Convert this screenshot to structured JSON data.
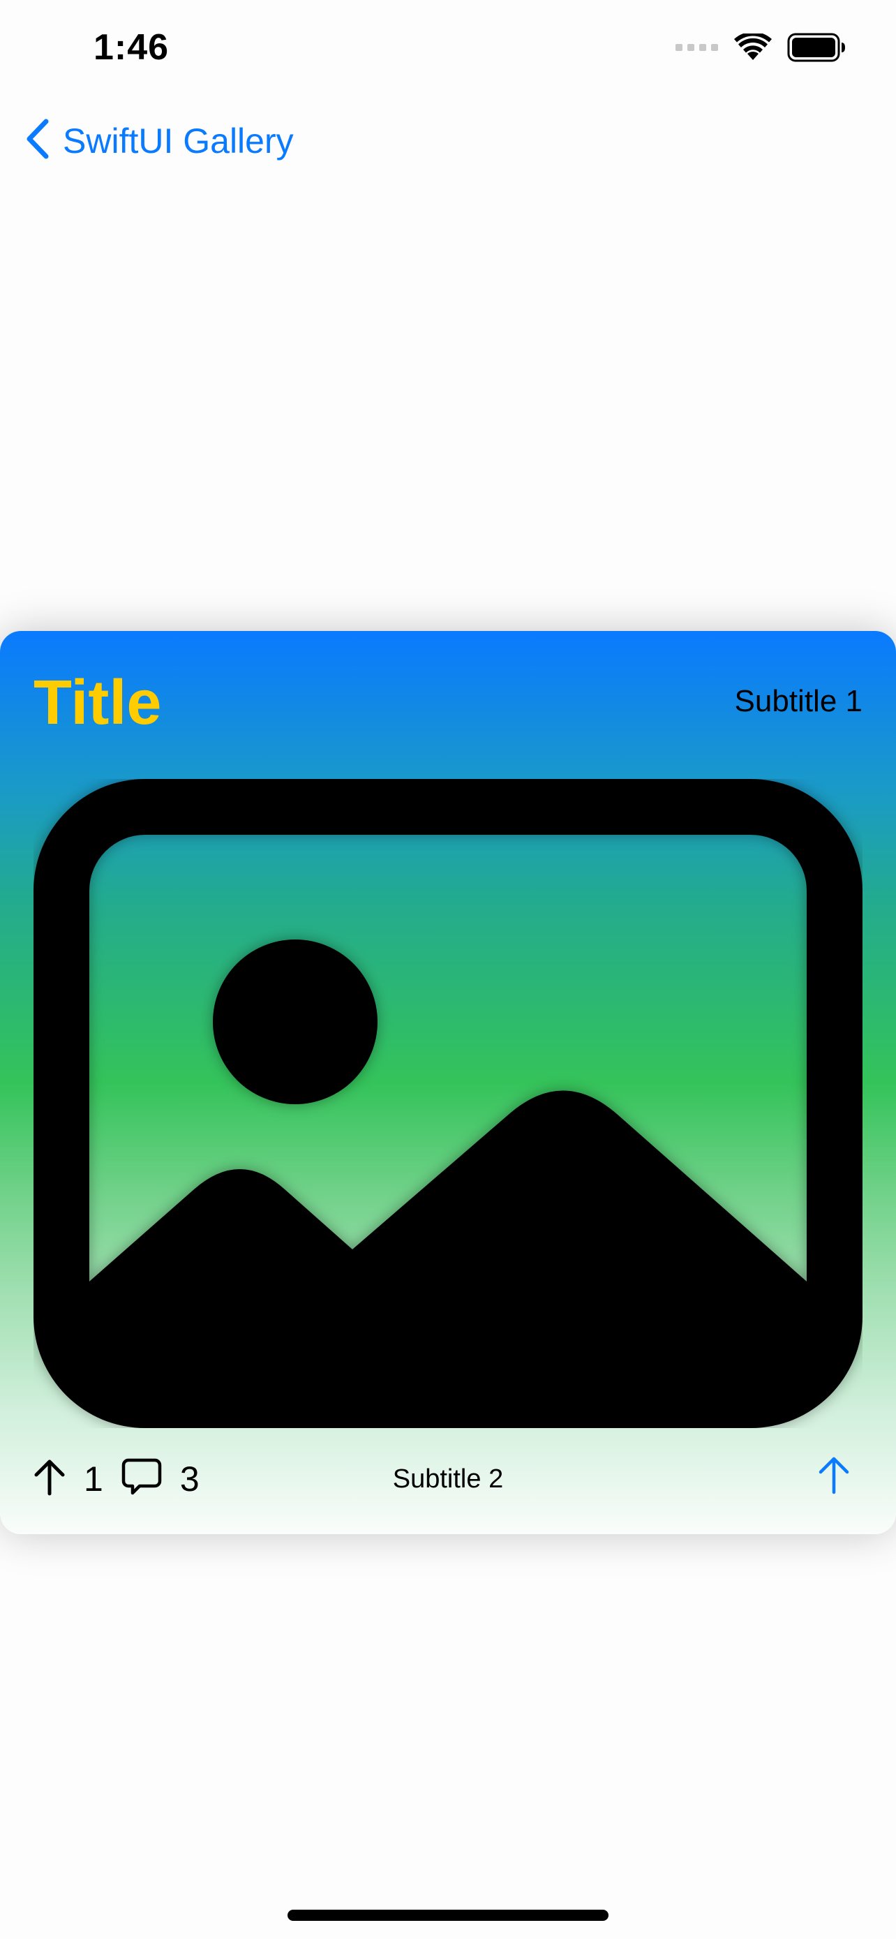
{
  "status_bar": {
    "time": "1:46"
  },
  "nav": {
    "back_label": "SwiftUI Gallery"
  },
  "card": {
    "title": "Title",
    "subtitle1": "Subtitle 1",
    "subtitle2": "Subtitle 2",
    "upvote_count": "1",
    "comment_count": "3"
  },
  "colors": {
    "accent": "#0a7aff",
    "title": "#ffcc00"
  },
  "icons": {
    "back": "chevron-left-icon",
    "photo": "photo-icon",
    "upvote": "arrow-up-icon",
    "comment": "message-bubble-icon",
    "share": "arrow-up-icon"
  }
}
